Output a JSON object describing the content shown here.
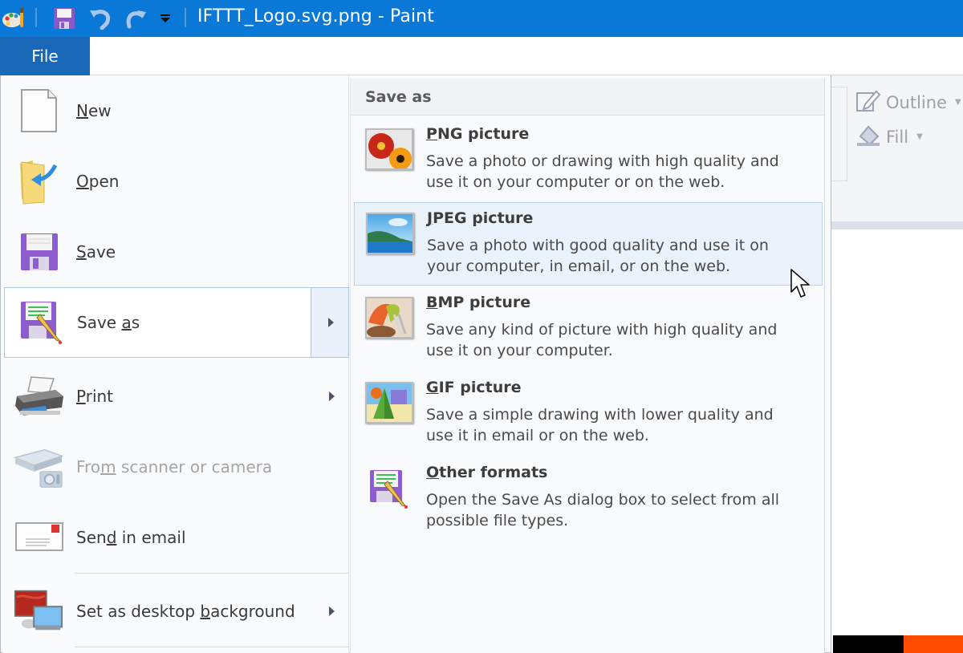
{
  "window": {
    "title": "IFTTT_Logo.svg.png - Paint",
    "quick_access": [
      {
        "name": "paint-app-icon"
      },
      {
        "name": "save-icon"
      },
      {
        "name": "undo-icon"
      },
      {
        "name": "redo-icon"
      },
      {
        "name": "customize-toolbar-icon"
      }
    ]
  },
  "ribbon": {
    "file_tab": "File",
    "outline_label": "Outline",
    "fill_label": "Fill"
  },
  "file_menu": {
    "items": [
      {
        "key": "new",
        "pre": "",
        "accel": "N",
        "post": "ew",
        "icon": "new-document-icon",
        "has_submenu": false,
        "disabled": false
      },
      {
        "key": "open",
        "pre": "",
        "accel": "O",
        "post": "pen",
        "icon": "open-folder-icon",
        "has_submenu": false,
        "disabled": false
      },
      {
        "key": "save",
        "pre": "",
        "accel": "S",
        "post": "ave",
        "icon": "save-disk-icon",
        "has_submenu": false,
        "disabled": false
      },
      {
        "key": "save-as",
        "pre": "Save ",
        "accel": "a",
        "post": "s",
        "icon": "save-as-icon",
        "has_submenu": true,
        "disabled": false,
        "selected": true
      },
      {
        "key": "print",
        "pre": "",
        "accel": "P",
        "post": "rint",
        "icon": "printer-icon",
        "has_submenu": true,
        "disabled": false
      },
      {
        "key": "from-scanner",
        "pre": "Fro",
        "accel": "m",
        "post": " scanner or camera",
        "icon": "scanner-camera-icon",
        "has_submenu": false,
        "disabled": true
      },
      {
        "key": "send-email",
        "pre": "Sen",
        "accel": "d",
        "post": " in email",
        "icon": "email-envelope-icon",
        "has_submenu": false,
        "disabled": false
      },
      {
        "key": "desktop-background",
        "pre": "Set as desktop ",
        "accel": "b",
        "post": "ackground",
        "icon": "desktop-background-icon",
        "has_submenu": true,
        "disabled": false
      }
    ]
  },
  "save_as_submenu": {
    "header": "Save as",
    "items": [
      {
        "key": "png",
        "accel": "P",
        "title_rest": "NG picture",
        "desc": "Save a photo or drawing with high quality and use it on your computer or on the web.",
        "icon": "png-picture-icon"
      },
      {
        "key": "jpeg",
        "accel": "J",
        "title_rest": "PEG picture",
        "desc": "Save a photo with good quality and use it on your computer, in email, or on the web.",
        "icon": "jpeg-picture-icon",
        "hover": true
      },
      {
        "key": "bmp",
        "accel": "B",
        "title_rest": "MP picture",
        "desc": "Save any kind of picture with high quality and use it on your computer.",
        "icon": "bmp-picture-icon"
      },
      {
        "key": "gif",
        "accel": "G",
        "title_rest": "IF picture",
        "desc": "Save a simple drawing with lower quality and use it in email or on the web.",
        "icon": "gif-picture-icon"
      },
      {
        "key": "other",
        "accel": "O",
        "title_rest": "ther formats",
        "desc": "Open the Save As dialog box to select from all possible file types.",
        "icon": "other-formats-icon"
      }
    ]
  },
  "colors": {
    "titlebar": "#0a78d7",
    "file_tab": "#1968b8",
    "selection_border": "#a7c6ea",
    "hover_bg": "#eaf2fc",
    "ifttt_orange": "#ff4b00"
  }
}
